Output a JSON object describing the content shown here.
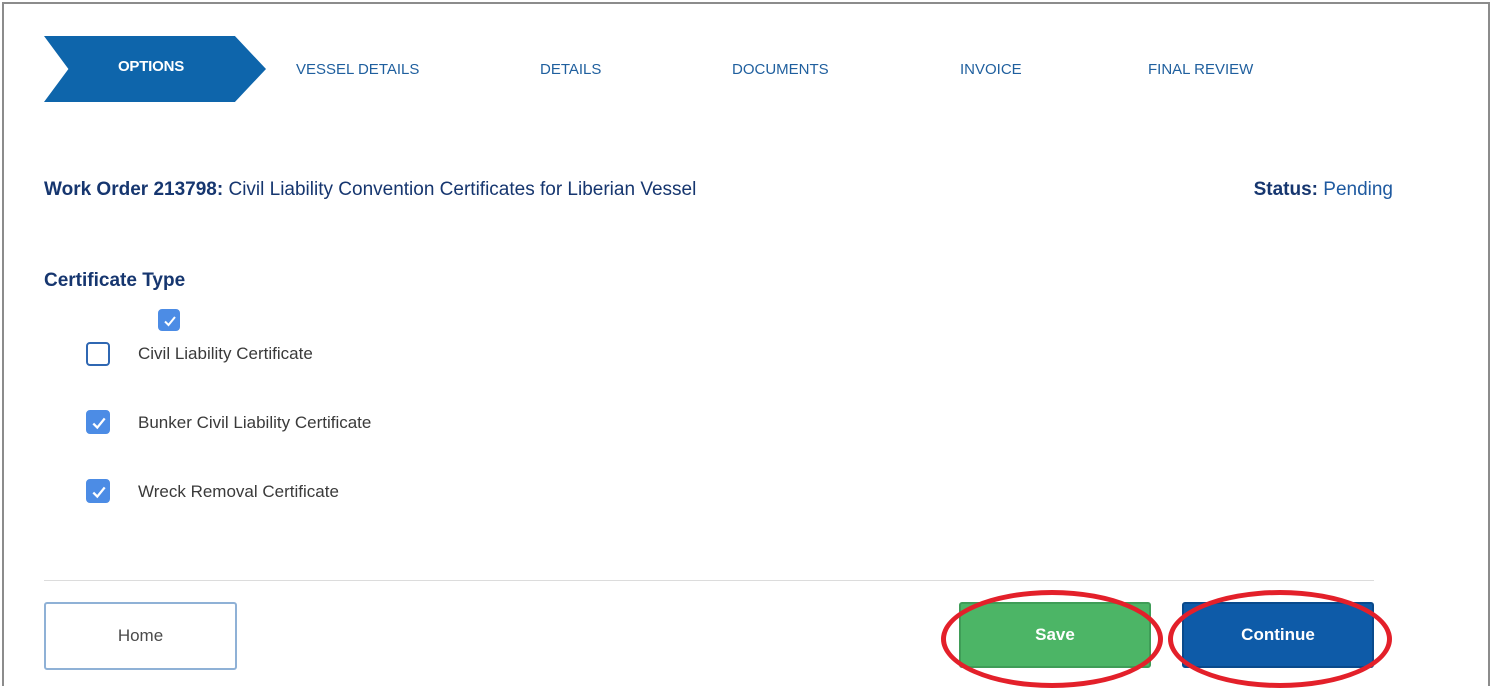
{
  "stepper": {
    "steps": [
      "OPTIONS",
      "VESSEL DETAILS",
      "DETAILS",
      "DOCUMENTS",
      "INVOICE",
      "FINAL REVIEW"
    ],
    "active_color": "#0e65ab"
  },
  "work_order": {
    "prefix": "Work Order 213798:",
    "title": "Civil Liability Convention Certificates for Liberian Vessel"
  },
  "status": {
    "label": "Status:",
    "value": "Pending"
  },
  "certificate_type": {
    "heading": "Certificate Type",
    "options": [
      {
        "label": "Civil Liability Certificate",
        "checked": false
      },
      {
        "label": "Bunker Civil Liability Certificate",
        "checked": true
      },
      {
        "label": "Wreck Removal Certificate",
        "checked": true
      }
    ]
  },
  "buttons": {
    "home": "Home",
    "save": "Save",
    "continue": "Continue"
  },
  "colors": {
    "save": "#4cb566",
    "continue": "#0e5ba8",
    "highlight_ring": "#e3202a"
  }
}
